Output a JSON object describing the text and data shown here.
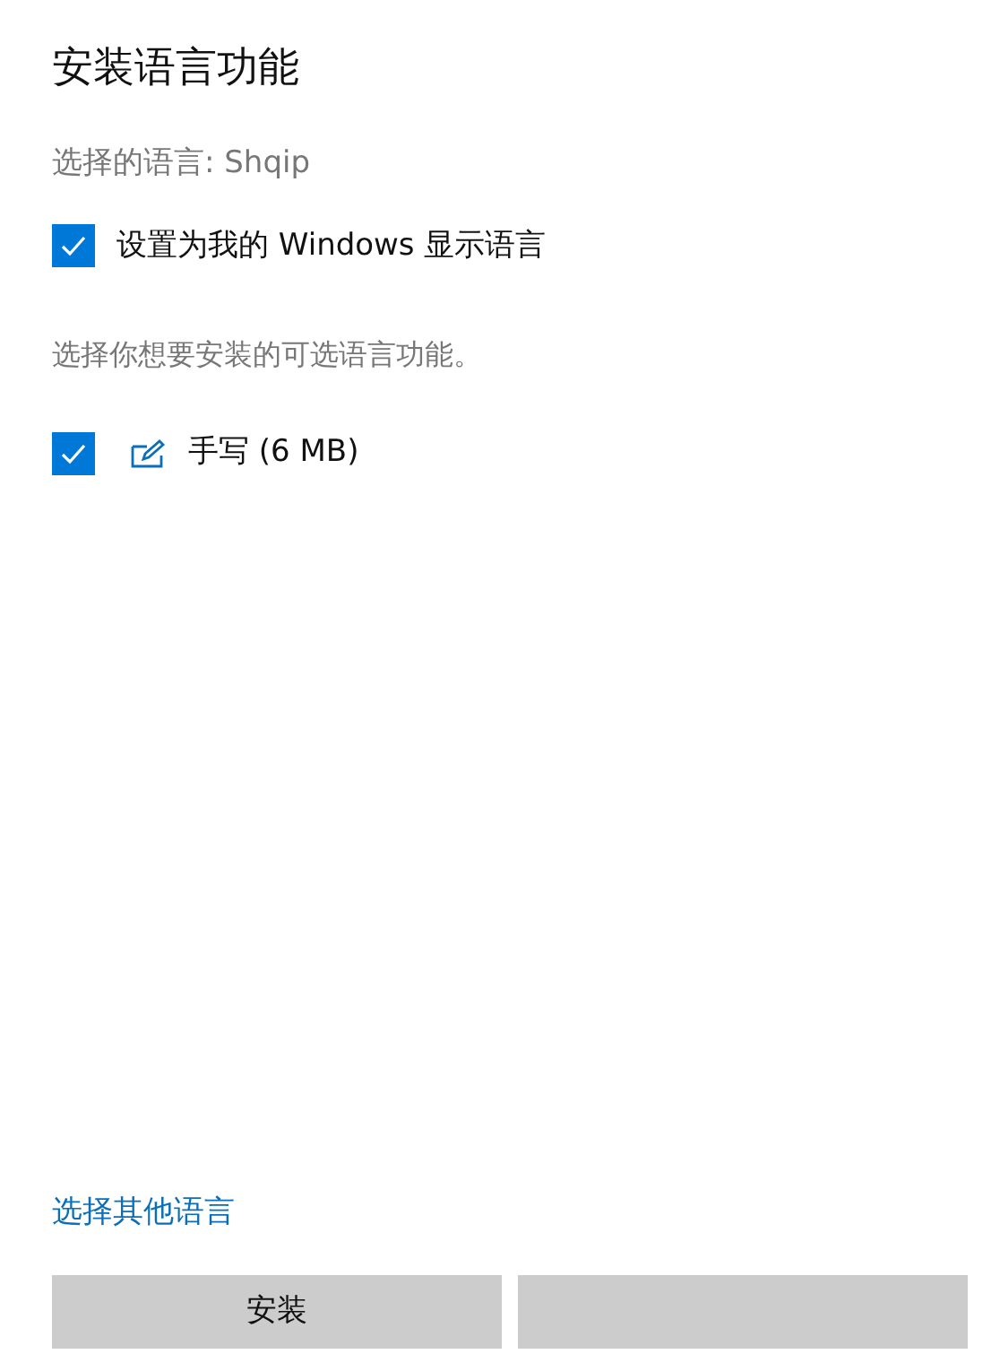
{
  "title": "安装语言功能",
  "selected_language": "选择的语言: Shqip",
  "display_language": {
    "label": "设置为我的 Windows 显示语言",
    "checked": true
  },
  "features_prompt": "选择你想要安装的可选语言功能。",
  "features": [
    {
      "label": "手写 (6 MB)",
      "checked": true
    }
  ],
  "other_language_link": "选择其他语言",
  "buttons": [
    {
      "kind": "labeled",
      "label": "安装"
    },
    {
      "kind": "covered"
    }
  ]
}
